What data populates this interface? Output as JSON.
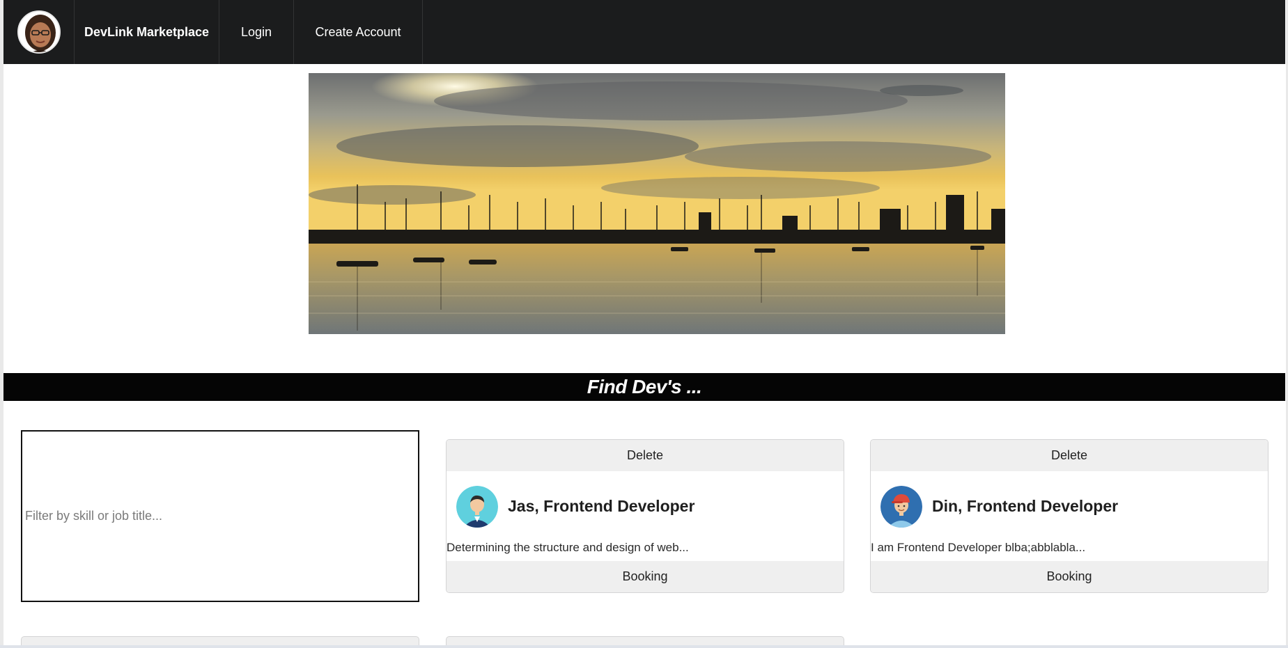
{
  "nav": {
    "brand": "DevLink Marketplace",
    "login": "Login",
    "create_account": "Create Account"
  },
  "banner": {
    "title": "Find Dev's ..."
  },
  "filter": {
    "placeholder": "Filter by skill or job title...",
    "value": ""
  },
  "cards": [
    {
      "delete_label": "Delete",
      "title": "Jas, Frontend Developer",
      "description": "Determining the structure and design of web...",
      "booking_label": "Booking"
    },
    {
      "delete_label": "Delete",
      "title": "Din, Frontend Developer",
      "description": "I am Frontend Developer blba;abblabla...",
      "booking_label": "Booking"
    }
  ],
  "colors": {
    "nav_bg": "#1b1c1d",
    "banner_bg": "#050505",
    "card_button_bg": "#efefef"
  }
}
